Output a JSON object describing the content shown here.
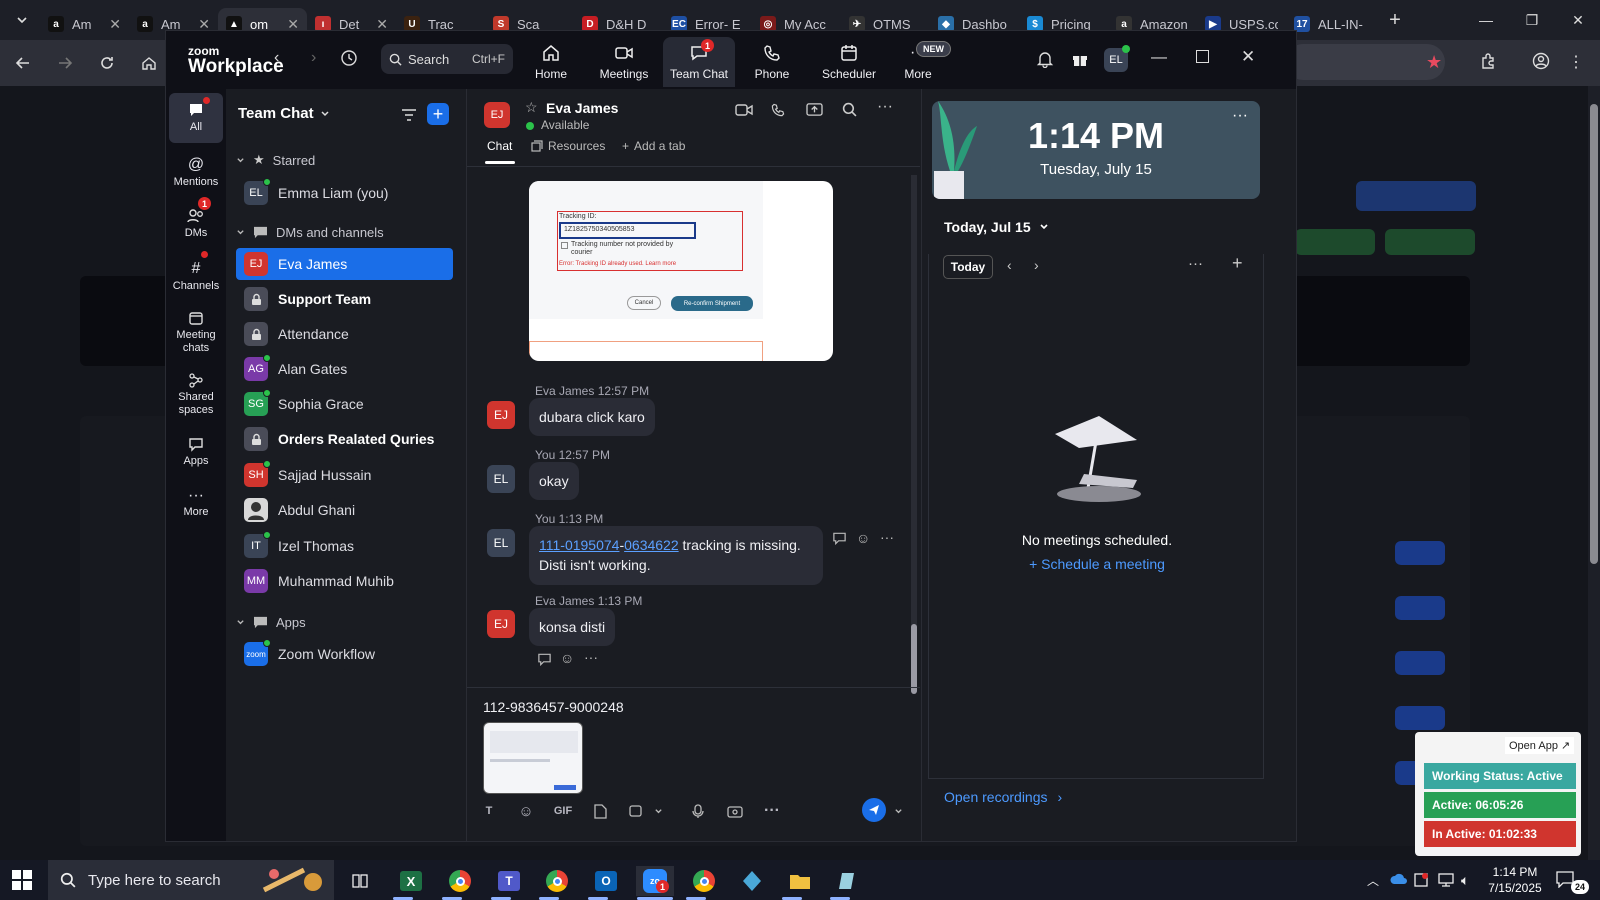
{
  "browser": {
    "tabs": [
      {
        "label": "Am",
        "fav": "a",
        "fav_color": "#111111"
      },
      {
        "label": "Am",
        "fav": "a",
        "fav_color": "#111111"
      },
      {
        "label": "om",
        "fav": "▲",
        "fav_color": "#111111"
      },
      {
        "label": "Det",
        "fav": "ı",
        "fav_color": "#c03030"
      },
      {
        "label": "Trac",
        "fav": "U",
        "fav_color": "#3b2210"
      },
      {
        "label": "Sca",
        "fav": "S",
        "fav_color": "#c0392b"
      },
      {
        "label": "D&H D",
        "fav": "D",
        "fav_color": "#c61d23"
      },
      {
        "label": "Error- E",
        "fav": "EC",
        "fav_color": "#1e4fa3"
      },
      {
        "label": "My Acc",
        "fav": "◎",
        "fav_color": "#7a1a1a"
      },
      {
        "label": "OTMS",
        "fav": "✈",
        "fav_color": "#333333"
      },
      {
        "label": "Dashbo",
        "fav": "◆",
        "fav_color": "#2a6fa8"
      },
      {
        "label": "Pricing",
        "fav": "$",
        "fav_color": "#1a8ad4"
      },
      {
        "label": "Amazon",
        "fav": "a",
        "fav_color": "#333333"
      },
      {
        "label": "USPS.co",
        "fav": "▶",
        "fav_color": "#1a3a8a"
      },
      {
        "label": "ALL-IN-",
        "fav": "17",
        "fav_color": "#2050a0"
      }
    ]
  },
  "zoom": {
    "logo_top": "zoom",
    "logo_bottom": "Workplace",
    "search_label": "Search",
    "search_shortcut": "Ctrl+F",
    "nav": [
      {
        "label": "Home"
      },
      {
        "label": "Meetings"
      },
      {
        "label": "Team Chat",
        "badge": "1"
      },
      {
        "label": "Phone"
      },
      {
        "label": "Scheduler"
      },
      {
        "label": "More",
        "badge": "NEW"
      }
    ],
    "avatar_initials": "EL",
    "rail": [
      {
        "label": "All"
      },
      {
        "label": "Mentions"
      },
      {
        "label": "DMs",
        "badge": "1"
      },
      {
        "label": "Channels"
      },
      {
        "label": "Meeting chats"
      },
      {
        "label": "Shared spaces"
      },
      {
        "label": "Apps"
      },
      {
        "label": "More"
      }
    ],
    "chatlist": {
      "title": "Team Chat",
      "sections": [
        "Starred",
        "DMs and channels",
        "Apps"
      ],
      "items": [
        {
          "label": "Emma Liam (you)",
          "initials": "EL",
          "color": "#3a4456"
        },
        {
          "label": "Eva James",
          "initials": "EJ",
          "color": "#d0352e"
        },
        {
          "label": "Support Team",
          "initials": "",
          "color": "#4a4c58"
        },
        {
          "label": "Attendance",
          "initials": "",
          "color": "#4a4c58"
        },
        {
          "label": "Alan Gates",
          "initials": "AG",
          "color": "#7a3aa8"
        },
        {
          "label": "Sophia Grace",
          "initials": "SG",
          "color": "#27a055"
        },
        {
          "label": "Orders Realated Quries",
          "initials": "",
          "color": "#4a4c58"
        },
        {
          "label": "Sajjad Hussain",
          "initials": "SH",
          "color": "#d0352e"
        },
        {
          "label": "Abdul Ghani",
          "initials": "",
          "color": "#d8d8d8"
        },
        {
          "label": "Izel Thomas",
          "initials": "IT",
          "color": "#3a4456"
        },
        {
          "label": "Muhammad Muhib",
          "initials": "MM",
          "color": "#7a3aa8"
        },
        {
          "label": "Zoom Workflow",
          "initials": "zoom",
          "color": "#1a6ee8"
        }
      ]
    },
    "chat": {
      "contact_name": "Eva James",
      "contact_initials": "EJ",
      "status": "Available",
      "tabs": [
        "Chat",
        "Resources",
        "Add a tab"
      ],
      "screenshot": {
        "field_label": "Tracking ID:",
        "field_value": "1Z1825750340505853",
        "checkbox_label": "Tracking number not provided by courier",
        "error_text": "Error: Tracking ID already used. Learn more",
        "cancel": "Cancel",
        "confirm": "Re-confirm Shipment"
      },
      "messages": [
        {
          "sender": "Eva James",
          "time": "12:57 PM",
          "initials": "EJ",
          "text": "dubara click karo"
        },
        {
          "sender": "You",
          "time": "12:57 PM",
          "initials": "EL",
          "text": "okay"
        },
        {
          "sender": "You",
          "time": "1:13 PM",
          "initials": "EL",
          "link1": "111-0195074",
          "sep": "-",
          "link2": "0634622",
          "text": " tracking is missing. Disti isn't working."
        },
        {
          "sender": "Eva James",
          "time": "1:13 PM",
          "initials": "EJ",
          "text": "konsa disti"
        }
      ],
      "composer_text": "112-9836457-9000248",
      "gif_label": "GIF"
    },
    "calendar": {
      "time": "1:14 PM",
      "date": "Tuesday, July 15",
      "day_label": "Today, Jul 15",
      "today_button": "Today",
      "empty_text": "No meetings scheduled.",
      "schedule_link": "Schedule a meeting",
      "recordings_link": "Open recordings"
    }
  },
  "widget": {
    "open_app": "Open App ↗",
    "working_status": "Working Status: Active",
    "active": "Active: 06:05:26",
    "inactive": "In Active: 01:02:33"
  },
  "taskbar": {
    "search_placeholder": "Type here to search",
    "clock_time": "1:14 PM",
    "clock_date": "7/15/2025",
    "notif_count": "24",
    "zoom_badge": "1"
  },
  "colors": {
    "accent": "#1a6ee8",
    "presence": "#2bc24a",
    "status_active": "#27a055",
    "status_inactive": "#d0352e",
    "status_working": "#3aa8a0"
  }
}
